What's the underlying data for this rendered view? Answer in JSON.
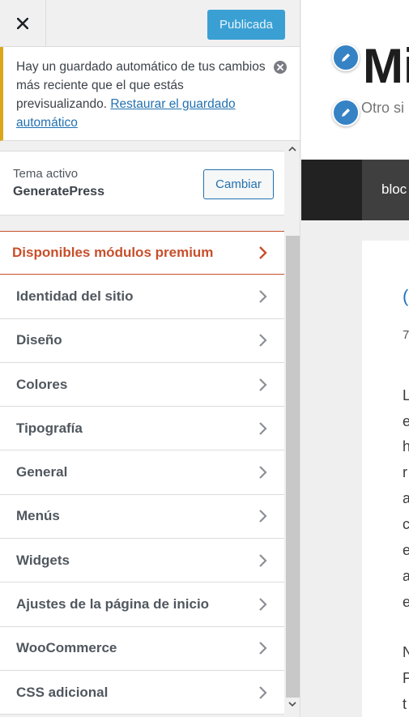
{
  "topbar": {
    "publish_label": "Publicada"
  },
  "notice": {
    "text": "Hay un guardado automático de tus cambios más reciente que el que estás previsualizando. ",
    "link": "Restaurar el guardado automático"
  },
  "theme": {
    "label": "Tema activo",
    "name": "GeneratePress",
    "change_label": "Cambiar"
  },
  "menu": {
    "items": [
      {
        "label": "Disponibles módulos premium"
      },
      {
        "label": "Identidad del sitio"
      },
      {
        "label": "Diseño"
      },
      {
        "label": "Colores"
      },
      {
        "label": "Tipografía"
      },
      {
        "label": "General"
      },
      {
        "label": "Menús"
      },
      {
        "label": "Widgets"
      },
      {
        "label": "Ajustes de la página de inicio"
      },
      {
        "label": "WooCommerce"
      },
      {
        "label": "CSS adicional"
      }
    ]
  },
  "preview": {
    "site_title": "Mi",
    "tagline": "Otro si",
    "nav_item": "bloc",
    "post_link": "(",
    "post_date": "7",
    "body_lines": [
      "L",
      "e",
      "h",
      "r",
      "a",
      "c",
      "e",
      "a",
      "e",
      "",
      "N",
      "P",
      "t"
    ]
  },
  "colors": {
    "accent": "#2271b1",
    "publish_bg": "#3aa0d4",
    "premium": "#c84f2b",
    "notice_border": "#dba617"
  }
}
